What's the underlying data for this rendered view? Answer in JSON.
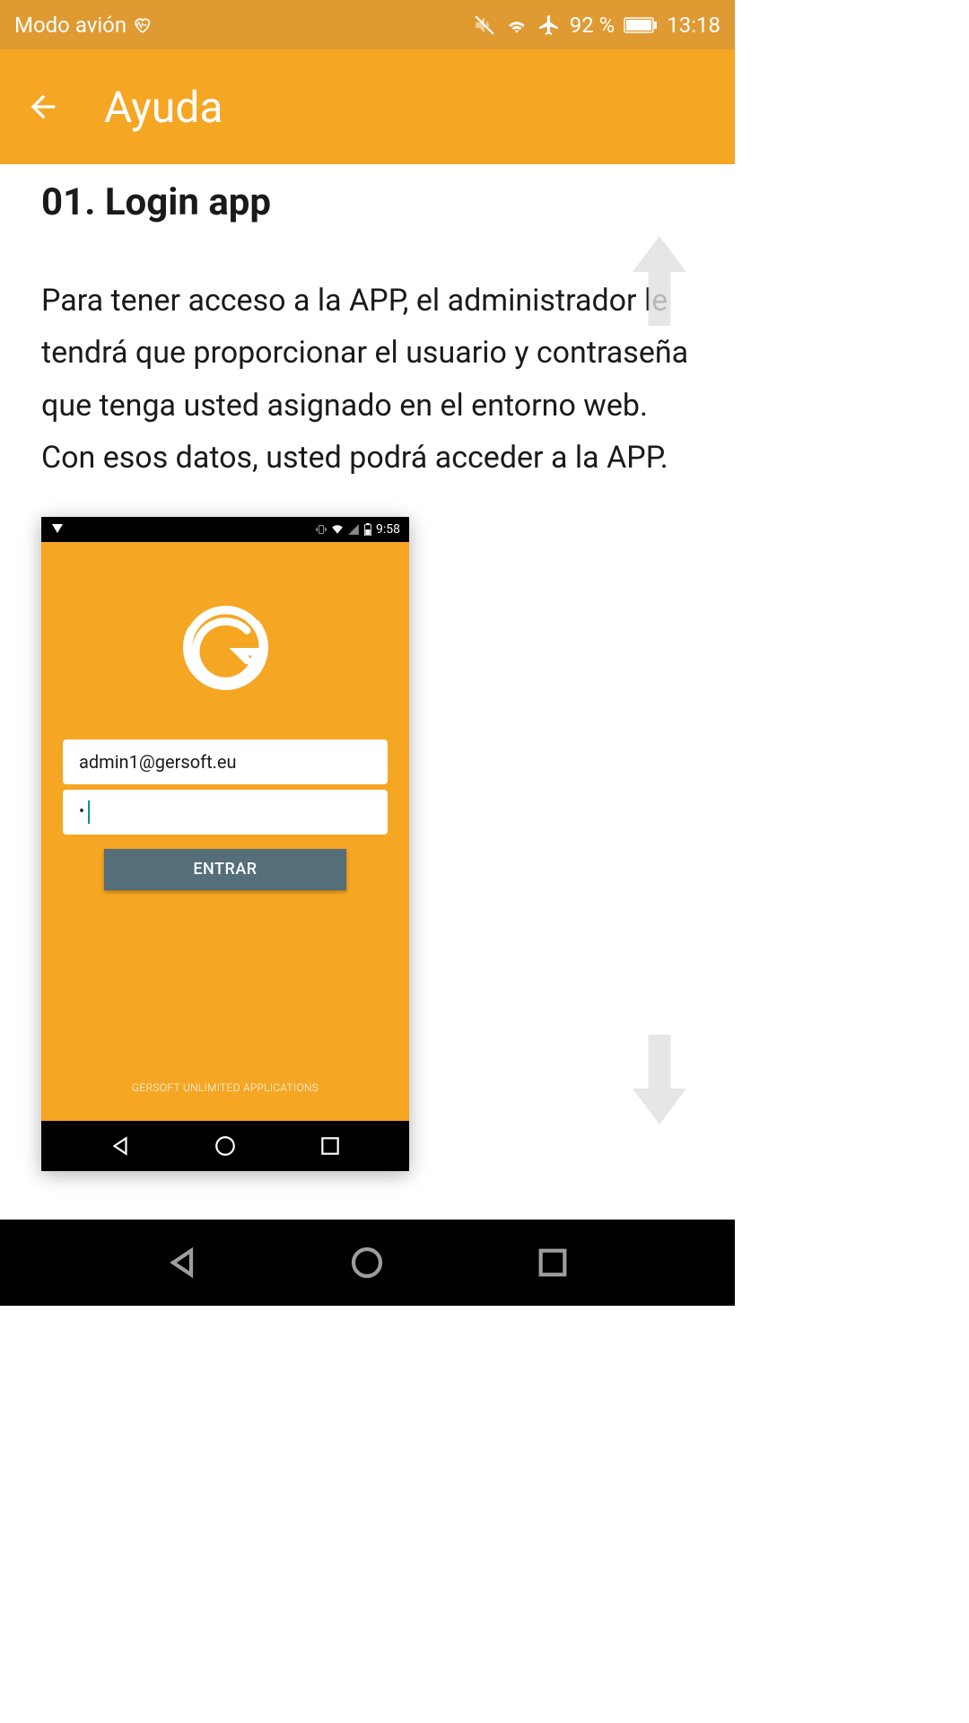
{
  "statusBar": {
    "mode": "Modo avión",
    "battery": "92 %",
    "time": "13:18"
  },
  "appBar": {
    "title": "Ayuda"
  },
  "section": {
    "title": "01. Login app",
    "text": "Para tener acceso a la APP, el administrador le tendrá que proporcionar el usuario y contraseña que tenga usted asignado en el entorno web. Con esos datos, usted podrá acceder a la APP."
  },
  "screenshot": {
    "time": "9:58",
    "email": "admin1@gersoft.eu",
    "passwordMask": "•",
    "button": "ENTRAR",
    "footer": "GERSOFT UNLIMITED APPLICATIONS"
  }
}
